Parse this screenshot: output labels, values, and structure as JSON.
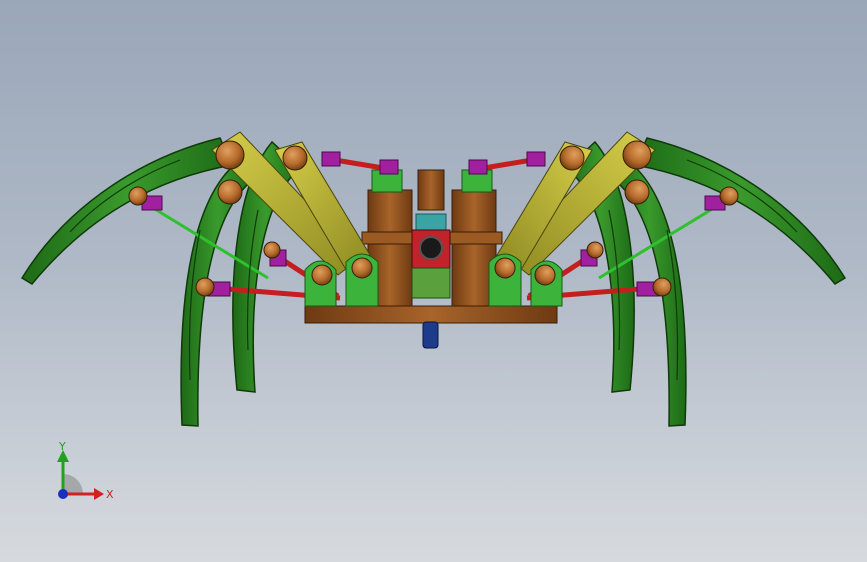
{
  "triad": {
    "x_label": "X",
    "y_label": "Y",
    "x_color": "#d42020",
    "y_color": "#22a022",
    "z_color": "#1a2fbf"
  },
  "colors": {
    "background_top": "#9aa7b9",
    "background_bottom": "#d6dade",
    "leg_green": "#2e8b22",
    "link_olive": "#b7b233",
    "body_brown": "#8a4f1c",
    "joint_bronze": "#b56a2a",
    "rod_red": "#c41e1e",
    "clip_magenta": "#a020a0",
    "block_green": "#3cb43c",
    "base_blue": "#1e3a8a"
  }
}
